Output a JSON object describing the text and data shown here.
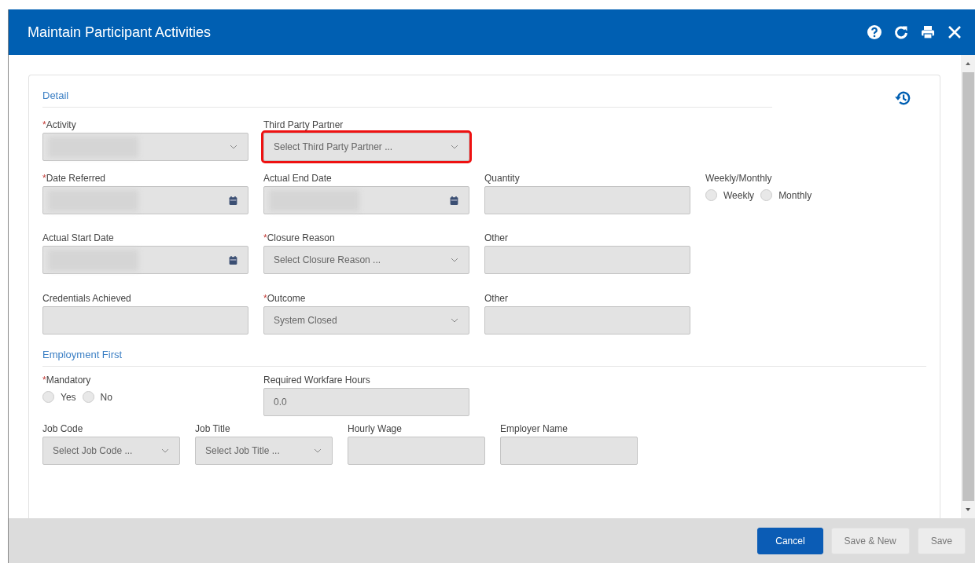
{
  "window": {
    "title": "Maintain Participant Activities"
  },
  "sections": [
    {
      "title": "Detail",
      "rows": [
        [
          {
            "kind": "select",
            "required_mark": "*",
            "label": "Activity",
            "redacted": true
          },
          {
            "kind": "select",
            "label": "Third Party Partner",
            "placeholder": "Select Third Party Partner ...",
            "highlighted": true
          }
        ],
        [
          {
            "kind": "date",
            "required_mark": "*",
            "label": "Date Referred",
            "redacted": true
          },
          {
            "kind": "date",
            "label": "Actual End Date",
            "redacted": true
          },
          {
            "kind": "text",
            "label": "Quantity"
          },
          {
            "kind": "radio",
            "label": "Weekly/Monthly",
            "options": [
              {
                "label": "Weekly",
                "selected": false
              },
              {
                "label": "Monthly",
                "selected": false
              }
            ]
          }
        ],
        [
          {
            "kind": "date",
            "label": "Actual Start Date",
            "redacted": true
          },
          {
            "kind": "select",
            "required_mark": "*",
            "label": "Closure Reason",
            "placeholder": "Select Closure Reason ..."
          },
          {
            "kind": "text",
            "label": "Other"
          }
        ],
        [
          {
            "kind": "text",
            "label": "Credentials Achieved"
          },
          {
            "kind": "select",
            "required_mark": "*",
            "label": "Outcome",
            "value": "System Closed"
          },
          {
            "kind": "text",
            "label": "Other"
          }
        ]
      ]
    },
    {
      "title": "Employment First",
      "rows": [
        [
          {
            "kind": "radio",
            "required_mark": "*",
            "label": "Mandatory",
            "options": [
              {
                "label": "Yes",
                "selected": false
              },
              {
                "label": "No",
                "selected": false
              }
            ]
          },
          {
            "kind": "text",
            "label": "Required Workfare Hours",
            "value": "0.0"
          }
        ],
        [
          {
            "kind": "select",
            "label": "Job Code",
            "placeholder": "Select Job Code ..."
          },
          {
            "kind": "select",
            "label": "Job Title",
            "placeholder": "Select Job Title ..."
          },
          {
            "kind": "text",
            "label": "Hourly Wage"
          },
          {
            "kind": "text",
            "label": "Employer Name"
          }
        ]
      ]
    }
  ],
  "buttons": [
    {
      "label": "Cancel",
      "primary": true
    },
    {
      "label": "Save & New",
      "primary": false
    },
    {
      "label": "Save",
      "primary": false
    }
  ]
}
